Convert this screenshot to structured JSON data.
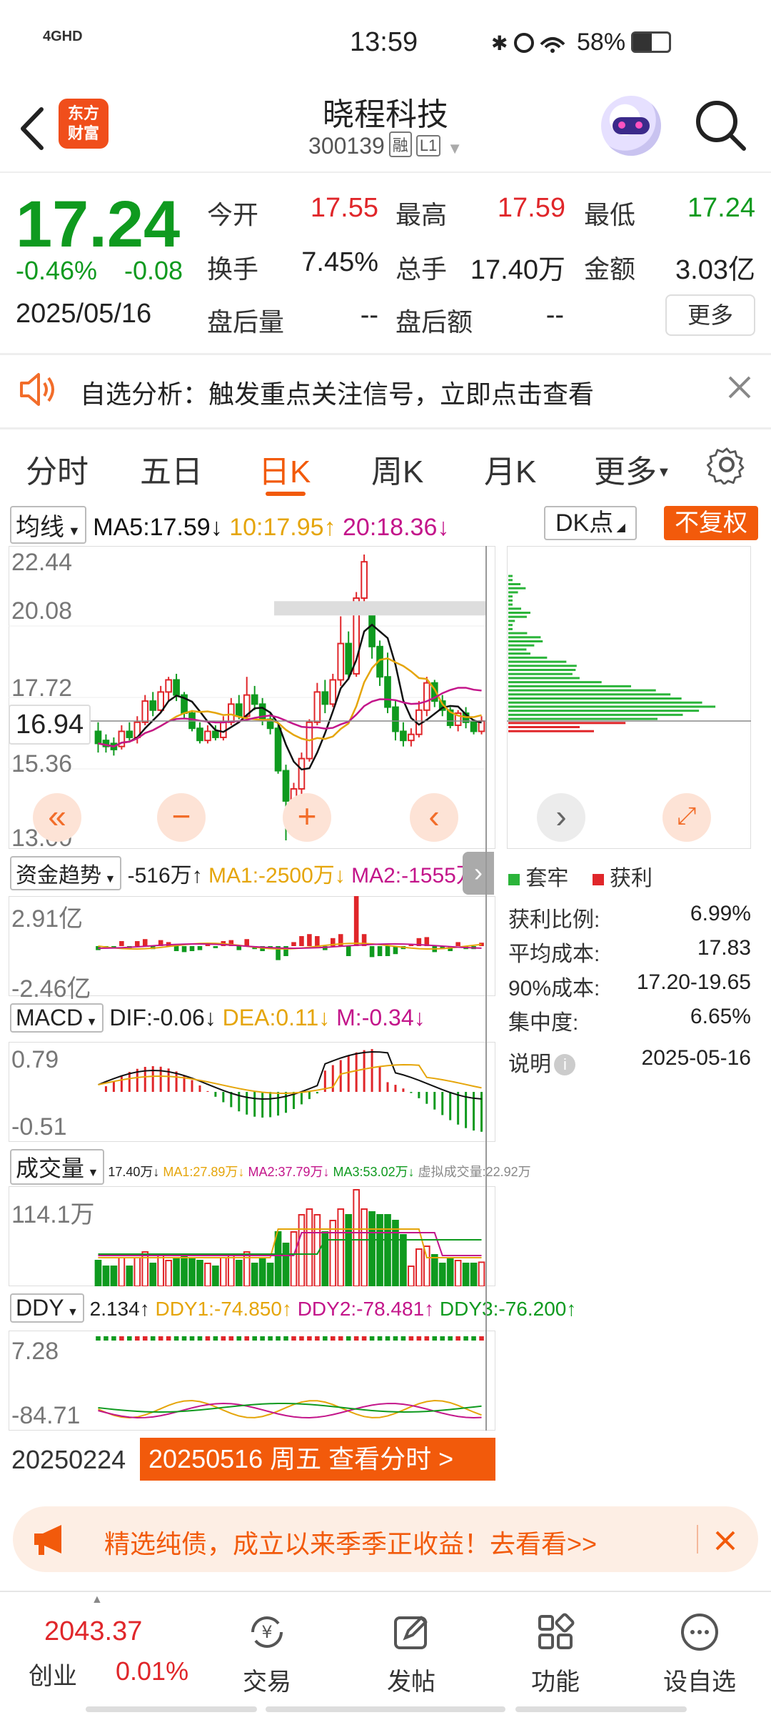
{
  "status_bar": {
    "network": "4GHD",
    "time": "13:59",
    "battery": "58%"
  },
  "header": {
    "app_logo": "东方\n财富",
    "stock_name": "晓程科技",
    "stock_code": "300139",
    "tag_margin": "融",
    "tag_level": "L1"
  },
  "quote": {
    "price": "17.24",
    "change_pct": "-0.46%",
    "change_amt": "-0.08",
    "date": "2025/05/16",
    "open_label": "今开",
    "open": "17.55",
    "high_label": "最高",
    "high": "17.59",
    "low_label": "最低",
    "low": "17.24",
    "turnover_label": "换手",
    "turnover": "7.45%",
    "volume_label": "总手",
    "volume": "17.40万",
    "amount_label": "金额",
    "amount": "3.03亿",
    "after_vol_label": "盘后量",
    "after_vol": "--",
    "after_amt_label": "盘后额",
    "after_amt": "--",
    "more_label": "更多"
  },
  "alert": {
    "text": "自选分析：触发重点关注信号，立即点击查看"
  },
  "tabs": [
    {
      "label": "分时"
    },
    {
      "label": "五日"
    },
    {
      "label": "日K"
    },
    {
      "label": "周K"
    },
    {
      "label": "月K"
    },
    {
      "label": "更多"
    }
  ],
  "kline": {
    "ma_selector": "均线",
    "ma5": "MA5:17.59",
    "ma10": "10:17.95",
    "ma20": "20:18.36",
    "dk_label": "DK点",
    "fq_label": "不复权",
    "y_labels": [
      "22.44",
      "20.08",
      "17.72",
      "15.36",
      "13.00"
    ],
    "current_price_tag": "16.94",
    "colors": {
      "up": "#e0262a",
      "down": "#0f9a1f",
      "ma5": "#111111",
      "ma10": "#e5a50a",
      "ma20": "#c3158a"
    }
  },
  "chip": {
    "legend_trapped": "套牢",
    "legend_profit": "获利",
    "rows": [
      {
        "label": "获利比例:",
        "value": "6.99%"
      },
      {
        "label": "平均成本:",
        "value": "17.83"
      },
      {
        "label": "90%成本:",
        "value": "17.20-19.65"
      },
      {
        "label": "集中度:",
        "value": "6.65%"
      }
    ],
    "note": "说明",
    "note_date": "2025-05-16"
  },
  "fund_trend": {
    "selector": "资金趋势",
    "value": "-516万",
    "ma1": "MA1:-2500万",
    "ma2": "MA2:-1555万",
    "y_top": "2.91亿",
    "y_bottom": "-2.46亿"
  },
  "macd": {
    "selector": "MACD",
    "dif": "DIF:-0.06",
    "dea": "DEA:0.11",
    "m": "M:-0.34",
    "y_top": "0.79",
    "y_bottom": "-0.51"
  },
  "volume": {
    "selector": "成交量",
    "legend": "17.40万",
    "ma1": "MA1:27.89万",
    "ma2": "MA2:37.79万",
    "ma3": "MA3:53.02万",
    "virtual": "虚拟成交量:22.92万",
    "y_top": "114.1万"
  },
  "ddy": {
    "selector": "DDY",
    "value": "2.134",
    "ddy1": "DDY1:-74.850",
    "ddy2": "DDY2:-78.481",
    "ddy3": "DDY3:-76.200",
    "y_top": "7.28",
    "y_bottom": "-84.71"
  },
  "date_bar": {
    "start": "20250224",
    "selected": "20250516 周五 查看分时 >"
  },
  "promo": {
    "text": "精选纯债，成立以来季季正收益！去看看>>"
  },
  "bottom_nav": {
    "index_value": "2043.37",
    "index_name": "创业",
    "index_change": "0.01%",
    "items": [
      {
        "label": "交易"
      },
      {
        "label": "发帖"
      },
      {
        "label": "功能"
      },
      {
        "label": "设自选"
      }
    ]
  },
  "candles": [
    {
      "o": 16.6,
      "c": 16.2,
      "h": 16.9,
      "l": 15.9
    },
    {
      "o": 16.3,
      "c": 16.1,
      "h": 16.5,
      "l": 15.9
    },
    {
      "o": 16.2,
      "c": 16.0,
      "h": 16.4,
      "l": 15.8
    },
    {
      "o": 16.1,
      "c": 16.6,
      "h": 16.8,
      "l": 16.0
    },
    {
      "o": 16.6,
      "c": 16.4,
      "h": 16.9,
      "l": 16.3
    },
    {
      "o": 16.4,
      "c": 16.9,
      "h": 17.1,
      "l": 16.2
    },
    {
      "o": 16.9,
      "c": 17.6,
      "h": 17.8,
      "l": 16.8
    },
    {
      "o": 17.6,
      "c": 17.3,
      "h": 17.9,
      "l": 17.1
    },
    {
      "o": 17.3,
      "c": 17.9,
      "h": 18.1,
      "l": 17.2
    },
    {
      "o": 17.9,
      "c": 18.3,
      "h": 18.4,
      "l": 17.6
    },
    {
      "o": 18.3,
      "c": 17.8,
      "h": 18.5,
      "l": 17.6
    },
    {
      "o": 17.8,
      "c": 17.2,
      "h": 17.9,
      "l": 17.0
    },
    {
      "o": 17.2,
      "c": 16.7,
      "h": 17.3,
      "l": 16.6
    },
    {
      "o": 16.7,
      "c": 16.3,
      "h": 16.9,
      "l": 16.2
    },
    {
      "o": 16.3,
      "c": 16.6,
      "h": 16.8,
      "l": 16.2
    },
    {
      "o": 16.6,
      "c": 16.4,
      "h": 16.8,
      "l": 16.3
    },
    {
      "o": 16.4,
      "c": 16.9,
      "h": 17.1,
      "l": 16.3
    },
    {
      "o": 16.9,
      "c": 17.5,
      "h": 17.7,
      "l": 16.8
    },
    {
      "o": 17.5,
      "c": 17.1,
      "h": 17.8,
      "l": 17.0
    },
    {
      "o": 17.1,
      "c": 17.8,
      "h": 18.4,
      "l": 17.0
    },
    {
      "o": 17.8,
      "c": 17.5,
      "h": 18.1,
      "l": 17.3
    },
    {
      "o": 17.5,
      "c": 17.0,
      "h": 17.7,
      "l": 16.8
    },
    {
      "o": 17.0,
      "c": 16.7,
      "h": 17.2,
      "l": 16.5
    },
    {
      "o": 16.7,
      "c": 15.3,
      "h": 16.8,
      "l": 15.2
    },
    {
      "o": 15.3,
      "c": 14.3,
      "h": 15.5,
      "l": 13.0
    },
    {
      "o": 14.3,
      "c": 14.7,
      "h": 14.9,
      "l": 14.1
    },
    {
      "o": 14.7,
      "c": 15.7,
      "h": 15.9,
      "l": 14.5
    },
    {
      "o": 15.7,
      "c": 16.9,
      "h": 17.0,
      "l": 15.6
    },
    {
      "o": 16.9,
      "c": 17.9,
      "h": 18.2,
      "l": 16.8
    },
    {
      "o": 17.9,
      "c": 17.5,
      "h": 18.3,
      "l": 17.2
    },
    {
      "o": 17.5,
      "c": 18.3,
      "h": 18.5,
      "l": 17.4
    },
    {
      "o": 18.3,
      "c": 19.5,
      "h": 20.4,
      "l": 18.1
    },
    {
      "o": 19.5,
      "c": 18.5,
      "h": 19.9,
      "l": 18.3
    },
    {
      "o": 18.5,
      "c": 21.0,
      "h": 21.2,
      "l": 18.4
    },
    {
      "o": 21.0,
      "c": 22.2,
      "h": 22.44,
      "l": 20.6
    },
    {
      "o": 20.5,
      "c": 19.4,
      "h": 20.6,
      "l": 19.0
    },
    {
      "o": 19.4,
      "c": 18.4,
      "h": 19.6,
      "l": 18.1
    },
    {
      "o": 18.4,
      "c": 17.4,
      "h": 19.2,
      "l": 17.2
    },
    {
      "o": 17.4,
      "c": 16.6,
      "h": 17.6,
      "l": 16.3
    },
    {
      "o": 16.6,
      "c": 16.3,
      "h": 16.9,
      "l": 16.1
    },
    {
      "o": 16.3,
      "c": 16.5,
      "h": 16.7,
      "l": 16.1
    },
    {
      "o": 16.5,
      "c": 17.3,
      "h": 17.6,
      "l": 16.4
    },
    {
      "o": 17.3,
      "c": 18.2,
      "h": 18.4,
      "l": 17.1
    },
    {
      "o": 18.2,
      "c": 17.6,
      "h": 18.3,
      "l": 17.4
    },
    {
      "o": 17.6,
      "c": 17.3,
      "h": 17.8,
      "l": 17.1
    },
    {
      "o": 17.3,
      "c": 16.8,
      "h": 17.4,
      "l": 16.7
    },
    {
      "o": 16.8,
      "c": 17.2,
      "h": 17.3,
      "l": 16.6
    },
    {
      "o": 17.2,
      "c": 16.9,
      "h": 17.4,
      "l": 16.7
    },
    {
      "o": 16.9,
      "c": 16.6,
      "h": 17.0,
      "l": 16.5
    },
    {
      "o": 16.6,
      "c": 16.94,
      "h": 17.1,
      "l": 16.5
    }
  ]
}
